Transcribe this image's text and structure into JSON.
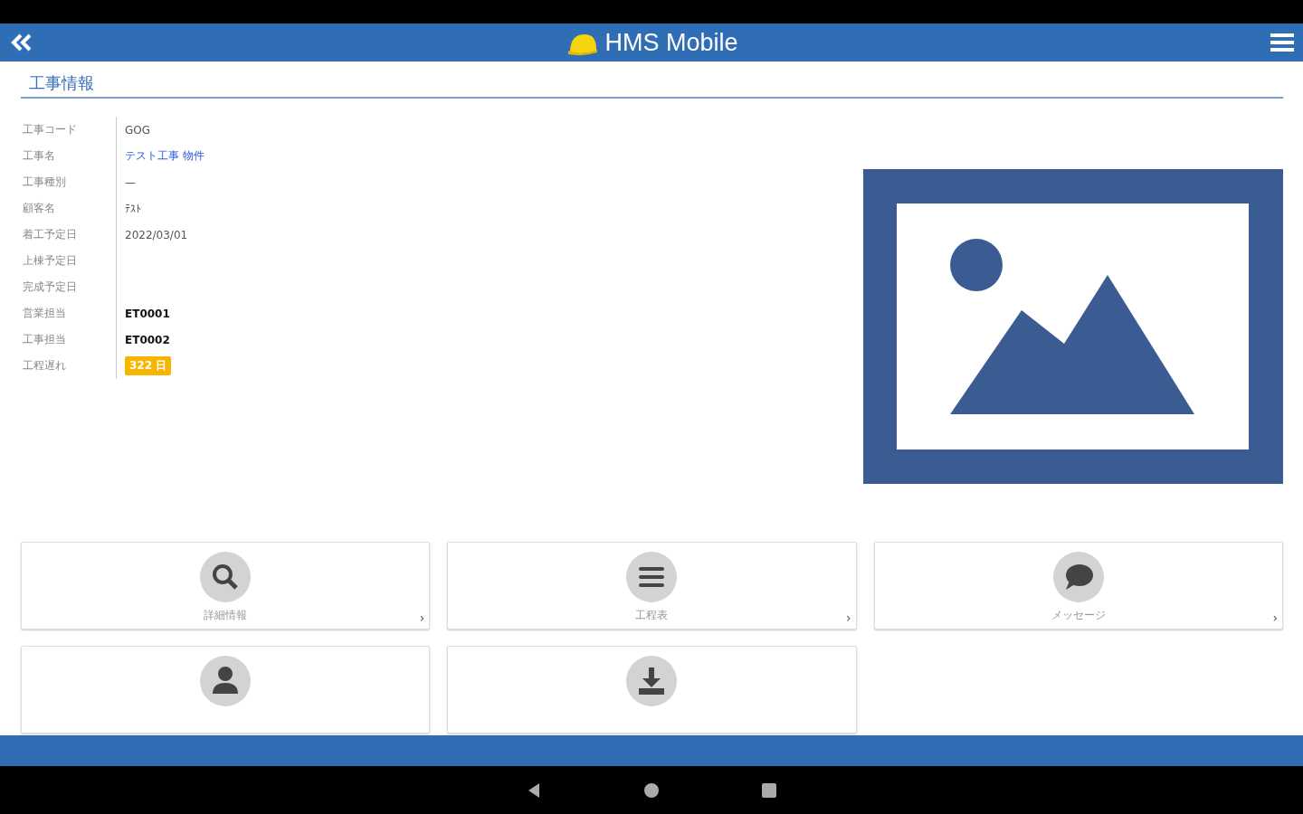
{
  "app_bar": {
    "title": "HMS Mobile"
  },
  "section": {
    "title": "工事情報"
  },
  "fields": [
    {
      "label": "工事コード",
      "value": "GOG",
      "kind": "text"
    },
    {
      "label": "工事名",
      "value": "テスト工事 物件",
      "kind": "link"
    },
    {
      "label": "工事種別",
      "value": "—",
      "kind": "text"
    },
    {
      "label": "顧客名",
      "value": "ﾃｽﾄ",
      "kind": "text"
    },
    {
      "label": "着工予定日",
      "value": "2022/03/01",
      "kind": "text"
    },
    {
      "label": "上棟予定日",
      "kind": "text"
    },
    {
      "label": "完成予定日",
      "kind": "text"
    },
    {
      "label": "営業担当",
      "value": "ET0001",
      "kind": "strong"
    },
    {
      "label": "工事担当",
      "value": "ET0002",
      "kind": "strong"
    },
    {
      "label": "工程遅れ",
      "value": "322 日",
      "kind": "badge"
    }
  ],
  "menu": [
    {
      "label": "詳細情報",
      "kind": "search",
      "arrow": "›"
    },
    {
      "label": "工程表",
      "kind": "list",
      "arrow": "›"
    },
    {
      "label": "メッセージ",
      "kind": "chat",
      "arrow": "›"
    },
    {
      "kind": "person"
    },
    {
      "kind": "download"
    }
  ]
}
